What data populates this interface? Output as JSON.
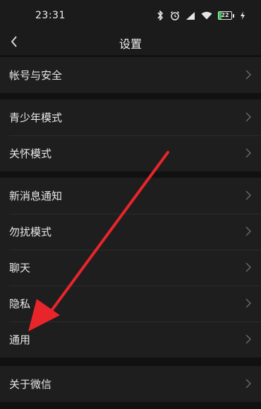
{
  "status_bar": {
    "time": "23:31",
    "battery_level": "22",
    "icons": [
      "bluetooth-icon",
      "alarm-icon",
      "signal-icon",
      "wifi-icon",
      "battery-icon",
      "charging-icon"
    ]
  },
  "nav": {
    "back_icon": "chevron-left-icon",
    "title": "设置"
  },
  "groups": [
    {
      "items": [
        {
          "label": "帐号与安全"
        }
      ]
    },
    {
      "items": [
        {
          "label": "青少年模式"
        },
        {
          "label": "关怀模式"
        }
      ]
    },
    {
      "items": [
        {
          "label": "新消息通知"
        },
        {
          "label": "勿扰模式"
        },
        {
          "label": "聊天"
        },
        {
          "label": "隐私"
        },
        {
          "label": "通用"
        }
      ]
    },
    {
      "items": [
        {
          "label": "关于微信"
        }
      ]
    }
  ],
  "annotation": {
    "color": "#e8252a",
    "points_to": "通用"
  },
  "colors": {
    "background": "#111111",
    "row_background": "#1e1e1e",
    "text": "#e8e8e8",
    "battery_fill": "#36c24b"
  }
}
